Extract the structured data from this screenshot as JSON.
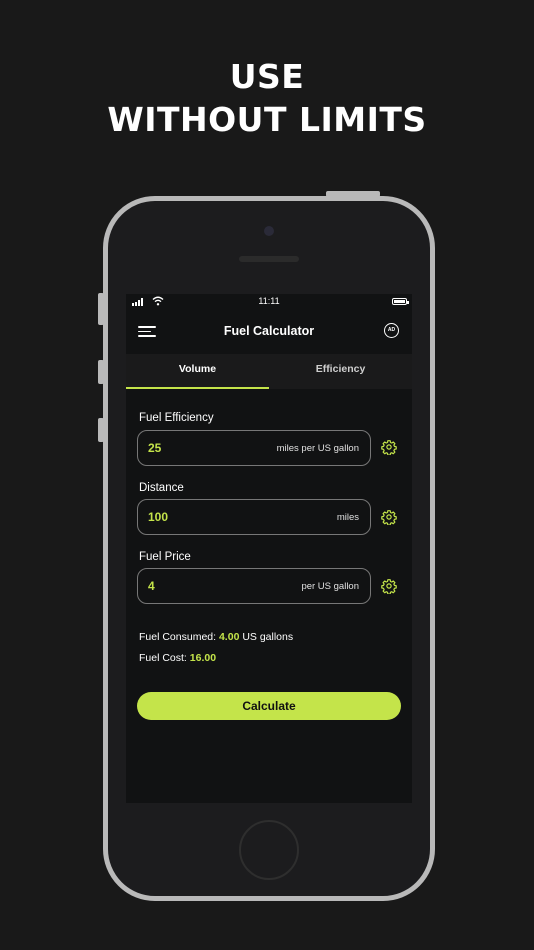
{
  "promo": {
    "line1": "USE",
    "line2": "WITHOUT LIMITS"
  },
  "status": {
    "time": "11:11"
  },
  "navbar": {
    "title": "Fuel Calculator",
    "ad_badge": "AD"
  },
  "tabs": [
    {
      "label": "Volume",
      "active": true
    },
    {
      "label": "Efficiency",
      "active": false
    }
  ],
  "fields": [
    {
      "label": "Fuel Efficiency",
      "value": "25",
      "unit": "miles per US gallon"
    },
    {
      "label": "Distance",
      "value": "100",
      "unit": "miles"
    },
    {
      "label": "Fuel Price",
      "value": "4",
      "unit": "per US gallon"
    }
  ],
  "results": {
    "consumed_label": "Fuel Consumed: ",
    "consumed_value": "4.00",
    "consumed_unit": " US gallons",
    "cost_label": "Fuel Cost: ",
    "cost_value": "16.00"
  },
  "calculate_label": "Calculate",
  "colors": {
    "accent": "#c4e44a",
    "background": "#191919",
    "screen": "#111213"
  }
}
